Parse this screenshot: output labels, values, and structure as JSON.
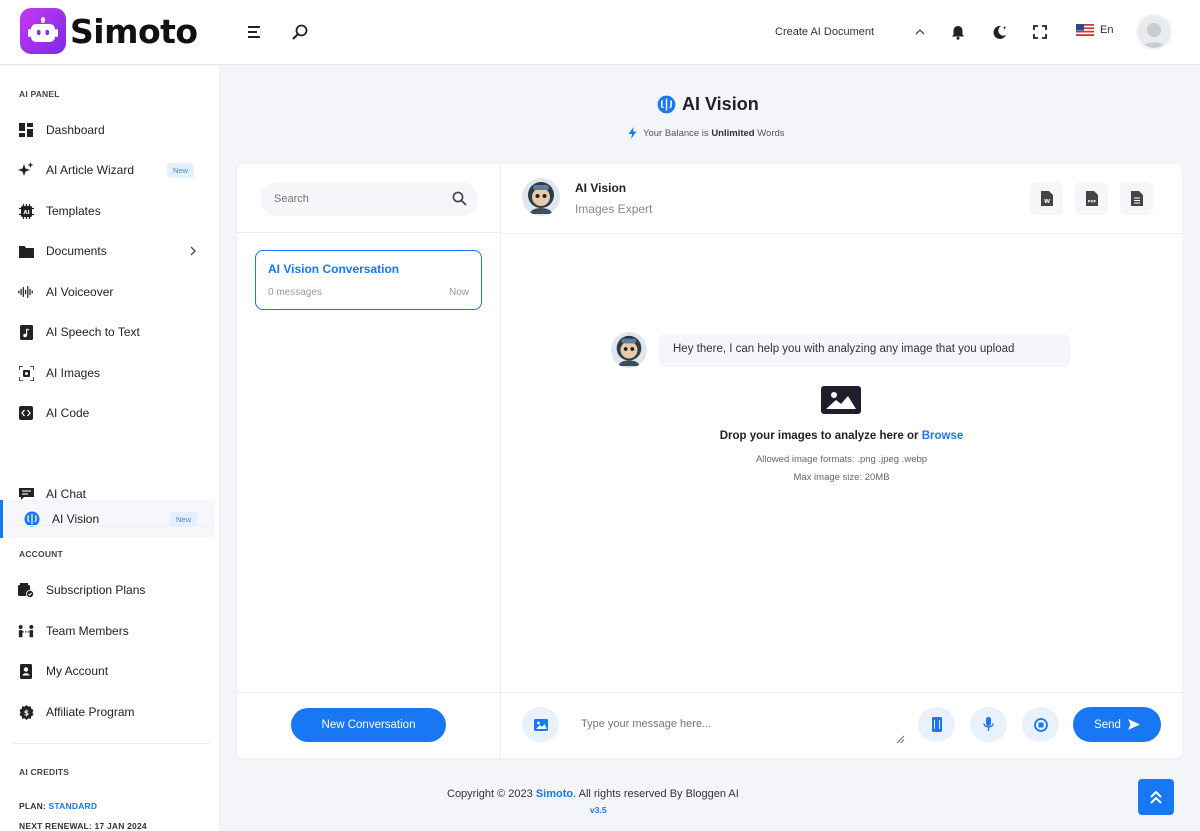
{
  "header": {
    "logo_text": "Simoto",
    "create_doc_label": "Create AI Document",
    "language": "En"
  },
  "sidebar": {
    "ai_panel_title": "AI PANEL",
    "items": [
      {
        "label": "Dashboard",
        "icon": "dashboard-icon"
      },
      {
        "label": "AI Article Wizard",
        "icon": "sparkle-icon",
        "badge": "New"
      },
      {
        "label": "Templates",
        "icon": "ai-chip-icon"
      },
      {
        "label": "Documents",
        "icon": "folder-icon"
      },
      {
        "label": "AI Voiceover",
        "icon": "waveform-icon"
      },
      {
        "label": "AI Speech to Text",
        "icon": "audio-file-icon"
      },
      {
        "label": "AI Images",
        "icon": "image-scan-icon"
      },
      {
        "label": "AI Code",
        "icon": "code-icon"
      },
      {
        "label": "AI Vision",
        "icon": "brain-icon",
        "badge": "New"
      },
      {
        "label": "AI Chat",
        "icon": "chat-icon"
      }
    ],
    "account_title": "ACCOUNT",
    "account_items": [
      {
        "label": "Subscription Plans",
        "icon": "subscription-icon"
      },
      {
        "label": "Team Members",
        "icon": "team-icon"
      },
      {
        "label": "My Account",
        "icon": "account-icon"
      },
      {
        "label": "Affiliate Program",
        "icon": "affiliate-icon"
      }
    ],
    "credits_title": "AI CREDITS",
    "plan_label": "PLAN:",
    "plan_value": "STANDARD",
    "renewal": "NEXT RENEWAL: 17 JAN 2024"
  },
  "page": {
    "title": "AI Vision",
    "balance_prefix": "Your Balance is",
    "balance_value": "Unlimited",
    "balance_suffix": "Words"
  },
  "conversations": {
    "search_placeholder": "Search",
    "items": [
      {
        "title": "AI Vision Conversation",
        "messages": "0 messages",
        "time": "Now"
      }
    ],
    "new_button": "New Conversation"
  },
  "chat": {
    "bot_name": "AI Vision",
    "bot_role": "Images Expert",
    "greeting": "Hey there, I can help you with analyzing any image that you upload",
    "drop_text": "Drop your images to analyze here or",
    "browse": "Browse",
    "formats": "Allowed image formats: .png .jpeg .webp",
    "max_size": "Max image size: 20MB",
    "input_placeholder": "Type your message here...",
    "send_label": "Send"
  },
  "footer": {
    "copyright_prefix": "Copyright © 2023",
    "brand": "Simoto",
    "copyright_suffix": ". All rights reserved By Bloggen AI",
    "version": "v3.5"
  },
  "colors": {
    "primary": "#1877f2",
    "logo_gradient_start": "#c53af2",
    "logo_gradient_end": "#7d29e8",
    "background": "#f3f5f9"
  }
}
